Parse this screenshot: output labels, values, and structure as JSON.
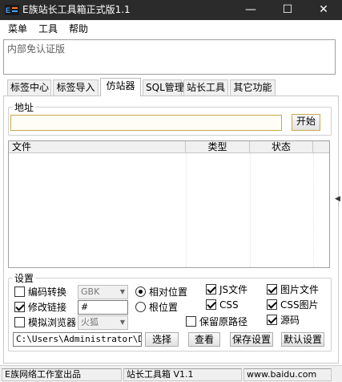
{
  "window": {
    "title": "E族站长工具箱正式版1.1",
    "min_glyph": "—",
    "max_glyph": "☐",
    "close_glyph": "✕"
  },
  "menu": [
    "菜单",
    "工具",
    "帮助"
  ],
  "notice": "内部免认证版",
  "tabs": [
    {
      "label": "标签中心",
      "active": false
    },
    {
      "label": "标签导入",
      "active": false
    },
    {
      "label": "仿站器",
      "active": true
    },
    {
      "label": "SQL管理",
      "active": false
    },
    {
      "label": "站长工具",
      "active": false
    },
    {
      "label": "其它功能",
      "active": false
    }
  ],
  "address": {
    "group_label": "地址",
    "value": "",
    "start_button": "开始"
  },
  "list": {
    "columns": [
      "文件",
      "类型",
      "状态"
    ],
    "rows": []
  },
  "settings": {
    "group_label": "设置",
    "encode_convert": {
      "label": "编码转换",
      "checked": false
    },
    "encode_select": "GBK",
    "modify_link": {
      "label": "修改链接",
      "checked": true
    },
    "link_prefix": "#",
    "simulate_browser": {
      "label": "模拟浏览器",
      "checked": false
    },
    "browser_select": "火狐",
    "relative_pos": {
      "label": "相对位置",
      "selected": true
    },
    "root_pos": {
      "label": "根位置",
      "selected": false
    },
    "js_files": {
      "label": "JS文件",
      "checked": true
    },
    "css": {
      "label": "CSS",
      "checked": true
    },
    "image_files": {
      "label": "图片文件",
      "checked": true
    },
    "css_images": {
      "label": "CSS图片",
      "checked": true
    },
    "keep_path": {
      "label": "保留原路径",
      "checked": false
    },
    "source": {
      "label": "源码",
      "checked": true
    },
    "save_path": "C:\\Users\\Administrator\\Desktop",
    "select_button": "选择",
    "view_button": "查看",
    "save_settings_button": "保存设置",
    "default_settings_button": "默认设置"
  },
  "status": {
    "company": "E族网络工作室出品",
    "version": "站长工具箱 V1.1",
    "site": "www.baidu.com"
  },
  "colors": {
    "titlebar": "#2b2b2b",
    "accent_border": "#c9a94a"
  }
}
